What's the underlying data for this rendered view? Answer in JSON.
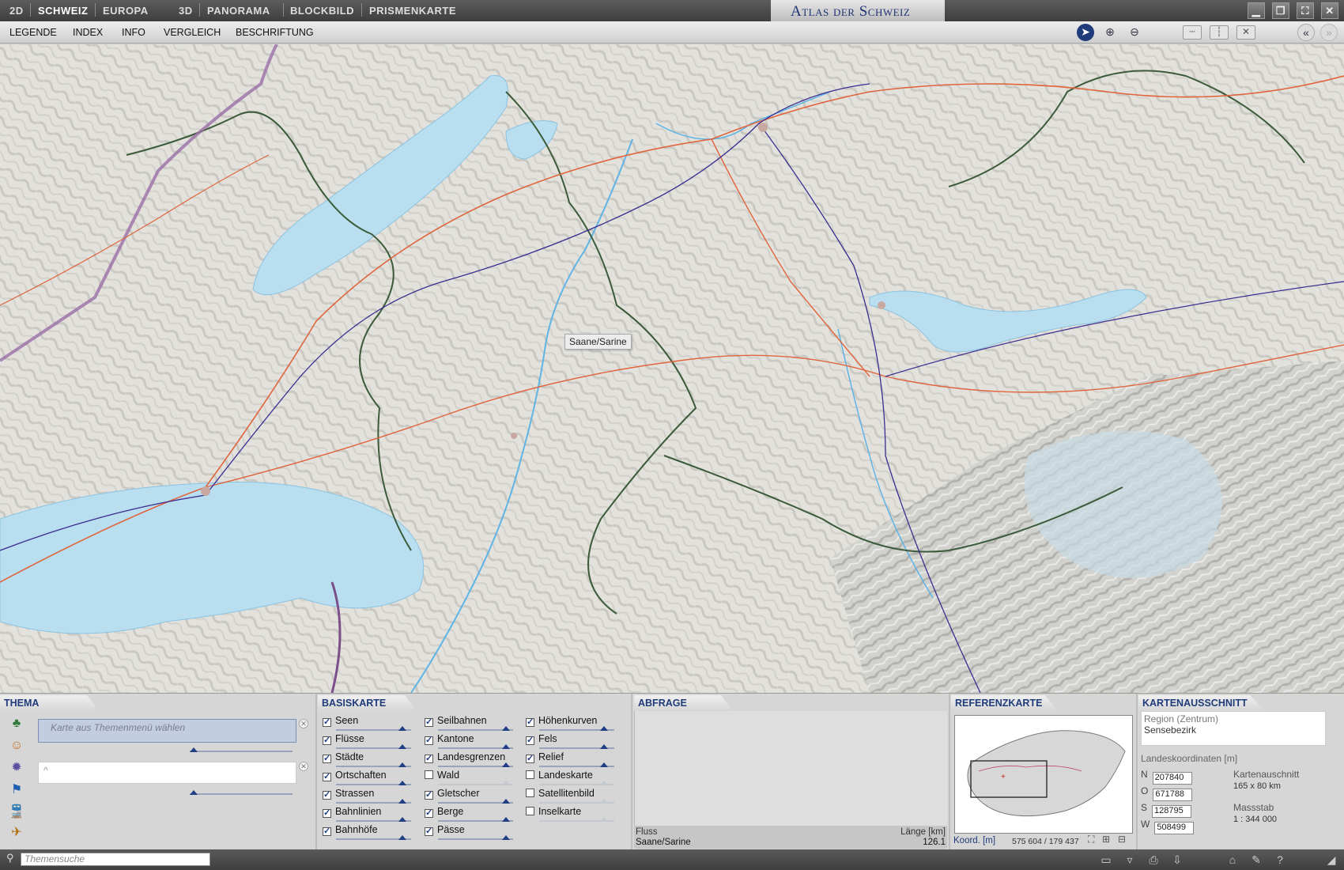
{
  "titlebar": {
    "modes": [
      "2D",
      "SCHWEIZ",
      "EUROPA",
      "3D",
      "PANORAMA",
      "BLOCKBILD",
      "PRISMENKARTE"
    ],
    "app_title": "Atlas der Schweiz"
  },
  "menubar": {
    "items": [
      "LEGENDE",
      "INDEX",
      "INFO",
      "VERGLEICH",
      "BESCHRIFTUNG"
    ]
  },
  "map": {
    "hover_label": "Saane/Sarine"
  },
  "thema": {
    "tab": "THEMA",
    "placeholder": "Karte aus Themenmenü wählen",
    "second_placeholder": "^"
  },
  "basiskarte": {
    "tab": "BASISKARTE",
    "columns": [
      [
        {
          "label": "Seen",
          "checked": true
        },
        {
          "label": "Flüsse",
          "checked": true
        },
        {
          "label": "Städte",
          "checked": true
        },
        {
          "label": "Ortschaften",
          "checked": true
        },
        {
          "label": "Strassen",
          "checked": true
        },
        {
          "label": "Bahnlinien",
          "checked": true
        },
        {
          "label": "Bahnhöfe",
          "checked": true
        }
      ],
      [
        {
          "label": "Seilbahnen",
          "checked": true
        },
        {
          "label": "Kantone",
          "checked": true
        },
        {
          "label": "Landesgrenzen",
          "checked": true
        },
        {
          "label": "Wald",
          "checked": false
        },
        {
          "label": "Gletscher",
          "checked": true
        },
        {
          "label": "Berge",
          "checked": true
        },
        {
          "label": "Pässe",
          "checked": true
        }
      ],
      [
        {
          "label": "Höhenkurven",
          "checked": true
        },
        {
          "label": "Fels",
          "checked": true
        },
        {
          "label": "Relief",
          "checked": true
        },
        {
          "label": "Landeskarte",
          "checked": false
        },
        {
          "label": "Satellitenbild",
          "checked": false
        },
        {
          "label": "Inselkarte",
          "checked": false
        }
      ]
    ]
  },
  "abfrage": {
    "tab": "ABFRAGE",
    "col1_header": "Fluss",
    "col2_header": "Länge [km]",
    "col1_value": "Saane/Sarine",
    "col2_value": "126.1"
  },
  "referenzkarte": {
    "tab": "REFERENZKARTE",
    "coord_label": "Koord. [m]",
    "coord_value": "575 604 / 179 437"
  },
  "kartenausschnitt": {
    "tab": "KARTENAUSSCHNITT",
    "region_label": "Region (Zentrum)",
    "region_value": "Sensebezirk",
    "coords_title": "Landeskoordinaten [m]",
    "coords": [
      {
        "dir": "N",
        "value": "207840"
      },
      {
        "dir": "O",
        "value": "671788"
      },
      {
        "dir": "S",
        "value": "128795"
      },
      {
        "dir": "W",
        "value": "508499"
      }
    ],
    "extent_label": "Kartenauschnitt",
    "extent_value": "165 x 80 km",
    "scale_label": "Massstab",
    "scale_value": "1 : 344 000"
  },
  "statusbar": {
    "search_placeholder": "Themensuche"
  },
  "colors": {
    "accent": "#1f3b7a",
    "lake": "#b9def0",
    "river": "#5fb4e6",
    "road": "#e0643c",
    "rail": "#3b2d8f",
    "canton_border": "#3c5b3a"
  }
}
